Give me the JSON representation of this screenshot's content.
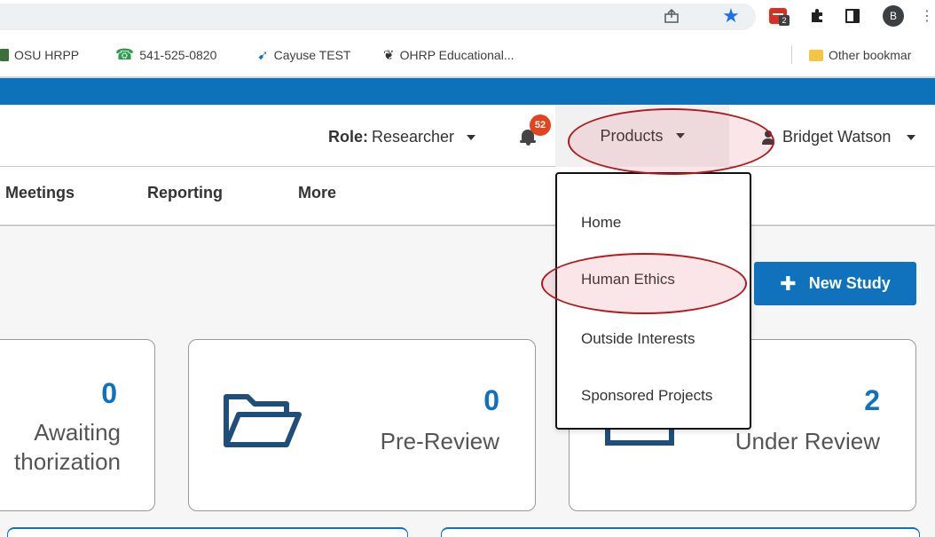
{
  "browser": {
    "extension_badge": "2",
    "profile_initial": "B",
    "bookmarks": [
      {
        "label": "OSU HRPP",
        "icon": "osu-icon"
      },
      {
        "label": "541-525-0820",
        "icon": "phone-icon"
      },
      {
        "label": "Cayuse TEST",
        "icon": "bird-icon"
      },
      {
        "label": "OHRP Educational...",
        "icon": "hhs-eagle-icon"
      }
    ],
    "other_bookmarks": "Other bookmar"
  },
  "header": {
    "role_label": "Role:",
    "role_value": "Researcher",
    "notification_count": "52",
    "products_label": "Products",
    "user_name": "Bridget Watson"
  },
  "nav": {
    "items": [
      {
        "label": "Meetings"
      },
      {
        "label": "Reporting"
      },
      {
        "label": "More"
      }
    ]
  },
  "products_menu": {
    "items": [
      {
        "label": "Home"
      },
      {
        "label": "Human Ethics"
      },
      {
        "label": "Outside Interests"
      },
      {
        "label": "Sponsored Projects"
      }
    ]
  },
  "actions": {
    "new_study": "New Study"
  },
  "cards": {
    "awaiting": {
      "count": "0",
      "label_line1": "Awaiting",
      "label_line2": "thorization"
    },
    "prereview": {
      "count": "0",
      "label": "Pre-Review"
    },
    "underreview": {
      "count": "2",
      "label": "Under Review"
    }
  },
  "colors": {
    "brand_blue": "#0d72b9",
    "accent_blue": "#1072bd",
    "badge_red": "#e0451f",
    "highlight_red": "#b0191e"
  }
}
